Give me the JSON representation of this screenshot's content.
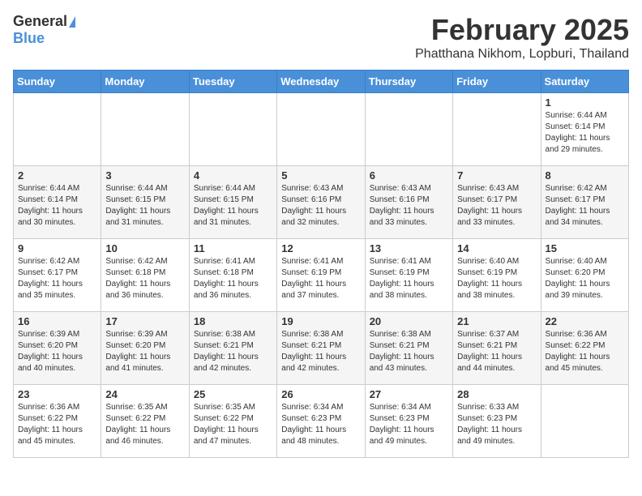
{
  "logo": {
    "general": "General",
    "blue": "Blue"
  },
  "header": {
    "title": "February 2025",
    "subtitle": "Phatthana Nikhom, Lopburi, Thailand"
  },
  "days_of_week": [
    "Sunday",
    "Monday",
    "Tuesday",
    "Wednesday",
    "Thursday",
    "Friday",
    "Saturday"
  ],
  "weeks": [
    [
      {
        "day": "",
        "info": ""
      },
      {
        "day": "",
        "info": ""
      },
      {
        "day": "",
        "info": ""
      },
      {
        "day": "",
        "info": ""
      },
      {
        "day": "",
        "info": ""
      },
      {
        "day": "",
        "info": ""
      },
      {
        "day": "1",
        "info": "Sunrise: 6:44 AM\nSunset: 6:14 PM\nDaylight: 11 hours and 29 minutes."
      }
    ],
    [
      {
        "day": "2",
        "info": "Sunrise: 6:44 AM\nSunset: 6:14 PM\nDaylight: 11 hours and 30 minutes."
      },
      {
        "day": "3",
        "info": "Sunrise: 6:44 AM\nSunset: 6:15 PM\nDaylight: 11 hours and 31 minutes."
      },
      {
        "day": "4",
        "info": "Sunrise: 6:44 AM\nSunset: 6:15 PM\nDaylight: 11 hours and 31 minutes."
      },
      {
        "day": "5",
        "info": "Sunrise: 6:43 AM\nSunset: 6:16 PM\nDaylight: 11 hours and 32 minutes."
      },
      {
        "day": "6",
        "info": "Sunrise: 6:43 AM\nSunset: 6:16 PM\nDaylight: 11 hours and 33 minutes."
      },
      {
        "day": "7",
        "info": "Sunrise: 6:43 AM\nSunset: 6:17 PM\nDaylight: 11 hours and 33 minutes."
      },
      {
        "day": "8",
        "info": "Sunrise: 6:42 AM\nSunset: 6:17 PM\nDaylight: 11 hours and 34 minutes."
      }
    ],
    [
      {
        "day": "9",
        "info": "Sunrise: 6:42 AM\nSunset: 6:17 PM\nDaylight: 11 hours and 35 minutes."
      },
      {
        "day": "10",
        "info": "Sunrise: 6:42 AM\nSunset: 6:18 PM\nDaylight: 11 hours and 36 minutes."
      },
      {
        "day": "11",
        "info": "Sunrise: 6:41 AM\nSunset: 6:18 PM\nDaylight: 11 hours and 36 minutes."
      },
      {
        "day": "12",
        "info": "Sunrise: 6:41 AM\nSunset: 6:19 PM\nDaylight: 11 hours and 37 minutes."
      },
      {
        "day": "13",
        "info": "Sunrise: 6:41 AM\nSunset: 6:19 PM\nDaylight: 11 hours and 38 minutes."
      },
      {
        "day": "14",
        "info": "Sunrise: 6:40 AM\nSunset: 6:19 PM\nDaylight: 11 hours and 38 minutes."
      },
      {
        "day": "15",
        "info": "Sunrise: 6:40 AM\nSunset: 6:20 PM\nDaylight: 11 hours and 39 minutes."
      }
    ],
    [
      {
        "day": "16",
        "info": "Sunrise: 6:39 AM\nSunset: 6:20 PM\nDaylight: 11 hours and 40 minutes."
      },
      {
        "day": "17",
        "info": "Sunrise: 6:39 AM\nSunset: 6:20 PM\nDaylight: 11 hours and 41 minutes."
      },
      {
        "day": "18",
        "info": "Sunrise: 6:38 AM\nSunset: 6:21 PM\nDaylight: 11 hours and 42 minutes."
      },
      {
        "day": "19",
        "info": "Sunrise: 6:38 AM\nSunset: 6:21 PM\nDaylight: 11 hours and 42 minutes."
      },
      {
        "day": "20",
        "info": "Sunrise: 6:38 AM\nSunset: 6:21 PM\nDaylight: 11 hours and 43 minutes."
      },
      {
        "day": "21",
        "info": "Sunrise: 6:37 AM\nSunset: 6:21 PM\nDaylight: 11 hours and 44 minutes."
      },
      {
        "day": "22",
        "info": "Sunrise: 6:36 AM\nSunset: 6:22 PM\nDaylight: 11 hours and 45 minutes."
      }
    ],
    [
      {
        "day": "23",
        "info": "Sunrise: 6:36 AM\nSunset: 6:22 PM\nDaylight: 11 hours and 45 minutes."
      },
      {
        "day": "24",
        "info": "Sunrise: 6:35 AM\nSunset: 6:22 PM\nDaylight: 11 hours and 46 minutes."
      },
      {
        "day": "25",
        "info": "Sunrise: 6:35 AM\nSunset: 6:22 PM\nDaylight: 11 hours and 47 minutes."
      },
      {
        "day": "26",
        "info": "Sunrise: 6:34 AM\nSunset: 6:23 PM\nDaylight: 11 hours and 48 minutes."
      },
      {
        "day": "27",
        "info": "Sunrise: 6:34 AM\nSunset: 6:23 PM\nDaylight: 11 hours and 49 minutes."
      },
      {
        "day": "28",
        "info": "Sunrise: 6:33 AM\nSunset: 6:23 PM\nDaylight: 11 hours and 49 minutes."
      },
      {
        "day": "",
        "info": ""
      }
    ]
  ]
}
